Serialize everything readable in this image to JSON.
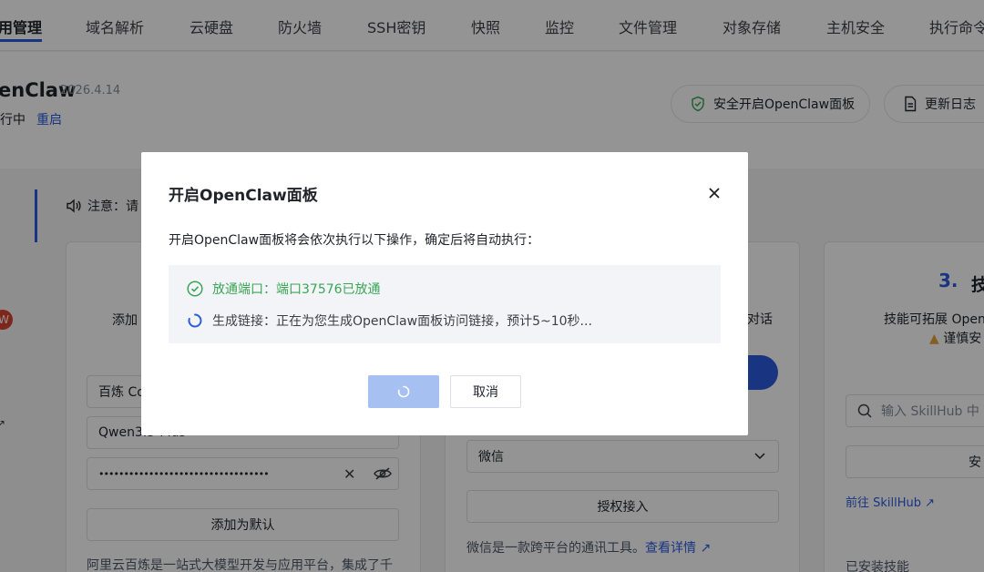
{
  "nav": {
    "tabs": [
      {
        "label": "用管理"
      },
      {
        "label": "域名解析"
      },
      {
        "label": "云硬盘"
      },
      {
        "label": "防火墙"
      },
      {
        "label": "SSH密钥"
      },
      {
        "label": "快照"
      },
      {
        "label": "监控"
      },
      {
        "label": "文件管理"
      },
      {
        "label": "对象存储"
      },
      {
        "label": "主机安全"
      },
      {
        "label": "执行命令"
      }
    ]
  },
  "header": {
    "app_name": "enClaw",
    "date": "2026.4.14",
    "status": "行中",
    "restart": "重启",
    "secure_open": "安全开启OpenClaw面板",
    "changelog": "更新日志"
  },
  "content": {
    "notice": "注意：请",
    "badge_letter": "W",
    "left_card": {
      "add_label": "添加",
      "provider": "百炼 Co",
      "model": "Qwen3.5-Plus",
      "api_key_masked": "••••••••••••••••••••••••••••••••••",
      "set_default": "添加为默认",
      "description": "阿里云百炼是一站式大模型开发与应用平台，集成了千"
    },
    "mid_card": {
      "side_text": "对话",
      "channel_selected": "微信",
      "authorize": "授权接入",
      "description": "微信是一款跨平台的通讯工具。",
      "detail_link": "查看详情"
    },
    "right_card": {
      "step_num": "3.",
      "title": "技",
      "line1": "技能可拓展 Open",
      "warning": "谨慎安",
      "search_placeholder": "输入 SkillHub 中",
      "install_btn": "安",
      "goto_skillhub": "前往 SkillHub",
      "installed": "已安装技能"
    }
  },
  "modal": {
    "title": "开启OpenClaw面板",
    "description": "开启OpenClaw面板将会依次执行以下操作，确定后将自动执行：",
    "steps": [
      {
        "label": "放通端口：端口37576已放通",
        "state": "done"
      },
      {
        "label": "生成链接：正在为您生成OpenClaw面板访问链接，预计5~10秒...",
        "state": "running"
      }
    ],
    "cancel": "取消"
  },
  "colors": {
    "primary": "#2c5ce0",
    "success": "#3aa655",
    "overlay": "rgba(0,0,0,0.42)"
  }
}
